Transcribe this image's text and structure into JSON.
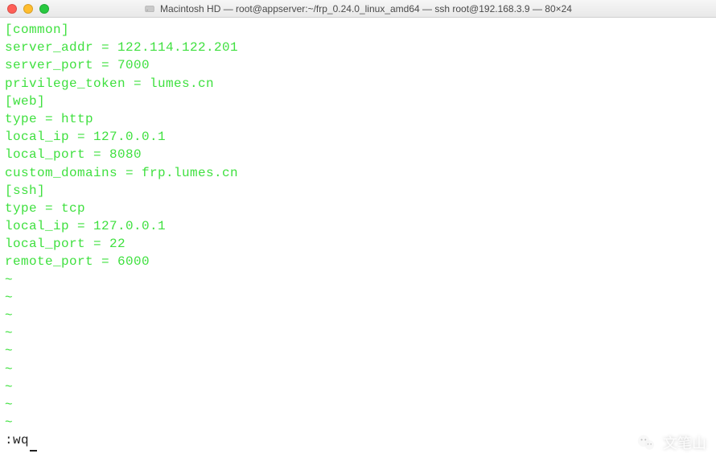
{
  "titlebar": {
    "disk_icon": "hdd-icon",
    "title": "Macintosh HD — root@appserver:~/frp_0.24.0_linux_amd64 — ssh root@192.168.3.9 — 80×24"
  },
  "editor": {
    "lines": [
      "[common]",
      "server_addr = 122.114.122.201",
      "server_port = 7000",
      "privilege_token = lumes.cn",
      "[web]",
      "type = http",
      "local_ip = 127.0.0.1",
      "local_port = 8080",
      "custom_domains = frp.lumes.cn",
      "[ssh]",
      "type = tcp",
      "local_ip = 127.0.0.1",
      "local_port = 22",
      "remote_port = 6000"
    ],
    "tilde_count": 9,
    "command": ":wq"
  },
  "watermark": {
    "text": "文笔山"
  }
}
